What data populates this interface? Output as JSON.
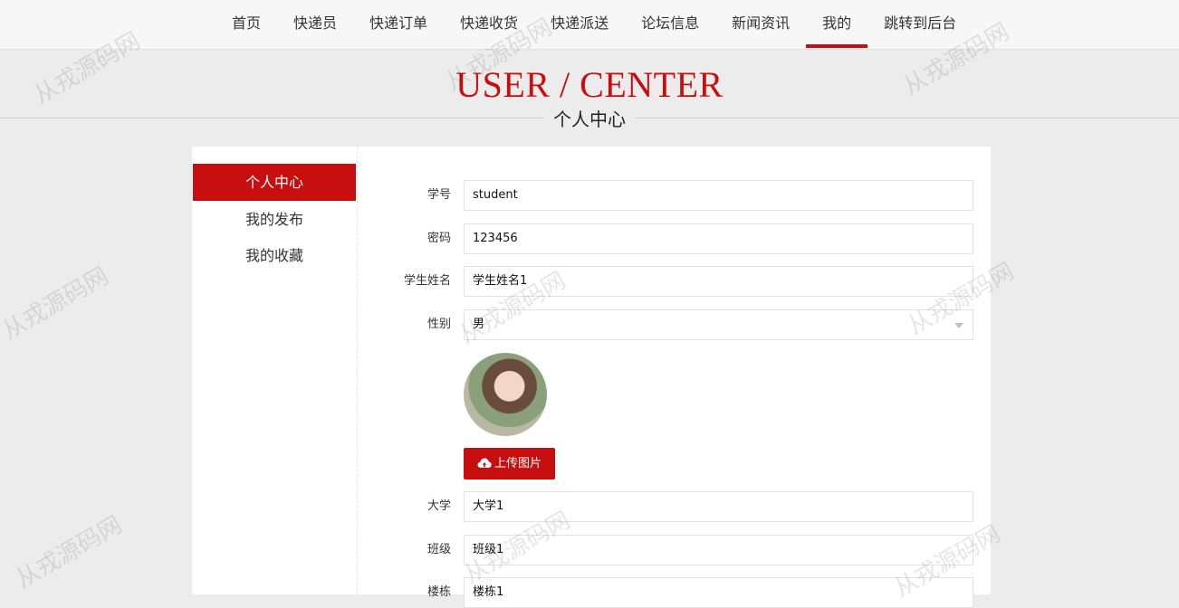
{
  "nav": {
    "items": [
      {
        "label": "首页"
      },
      {
        "label": "快递员"
      },
      {
        "label": "快递订单"
      },
      {
        "label": "快递收货"
      },
      {
        "label": "快递派送"
      },
      {
        "label": "论坛信息"
      },
      {
        "label": "新闻资讯"
      },
      {
        "label": "我的"
      },
      {
        "label": "跳转到后台"
      }
    ],
    "active": "我的"
  },
  "banner": {
    "title": "USER / CENTER",
    "subtitle": "个人中心"
  },
  "sidebar": {
    "items": [
      {
        "label": "个人中心"
      },
      {
        "label": "我的发布"
      },
      {
        "label": "我的收藏"
      }
    ]
  },
  "form": {
    "student_id": {
      "label": "学号",
      "value": "student"
    },
    "password": {
      "label": "密码",
      "value": "123456"
    },
    "name": {
      "label": "学生姓名",
      "value": "学生姓名1"
    },
    "gender": {
      "label": "性别",
      "value": "男"
    },
    "upload_label": "上传图片",
    "university": {
      "label": "大学",
      "value": "大学1"
    },
    "class": {
      "label": "班级",
      "value": "班级1"
    },
    "building": {
      "label": "楼栋",
      "value": "楼栋1"
    }
  },
  "watermark": "从戎源码网",
  "colors": {
    "accent": "#c80f10",
    "background": "#ececec"
  }
}
